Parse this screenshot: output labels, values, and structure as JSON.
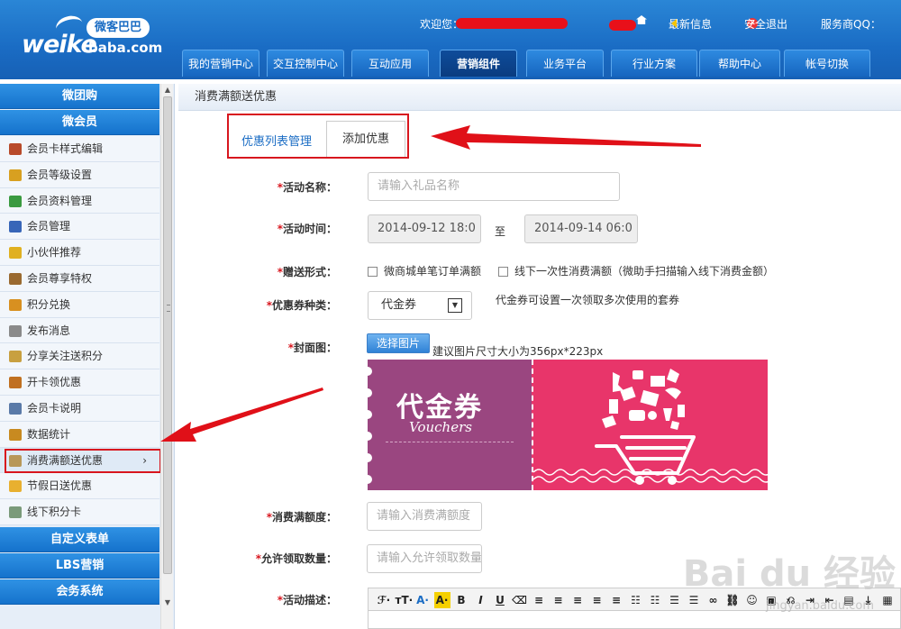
{
  "header": {
    "logo_main": "weike",
    "logo_sub": "baba.com",
    "logo_cn": "微客巴巴",
    "welcome": "欢迎您：",
    "latest_info": "最新信息",
    "logout": "安全退出",
    "provider_qq": "服务商QQ："
  },
  "nav": {
    "tabs": [
      "我的营销中心",
      "交互控制中心",
      "互动应用",
      "营销组件",
      "业务平台",
      "行业方案",
      "帮助中心",
      "帐号切换"
    ],
    "active": "营销组件"
  },
  "sidebar": {
    "groups_top": [
      "微团购",
      "微会员"
    ],
    "items": [
      {
        "label": "会员卡样式编辑",
        "color": "#b84a2a"
      },
      {
        "label": "会员等级设置",
        "color": "#d8a020"
      },
      {
        "label": "会员资料管理",
        "color": "#3a9a40"
      },
      {
        "label": "会员管理",
        "color": "#3866b8"
      },
      {
        "label": "小伙伴推荐",
        "color": "#e0b020"
      },
      {
        "label": "会员尊享特权",
        "color": "#9a6a30"
      },
      {
        "label": "积分兑换",
        "color": "#d89020"
      },
      {
        "label": "发布消息",
        "color": "#8a8a8a"
      },
      {
        "label": "分享关注送积分",
        "color": "#c8a040"
      },
      {
        "label": "开卡领优惠",
        "color": "#c07020"
      },
      {
        "label": "会员卡说明",
        "color": "#5a7aa8"
      },
      {
        "label": "数据统计",
        "color": "#c88a20"
      },
      {
        "label": "消费满额送优惠",
        "color": "#b89858",
        "active": true
      },
      {
        "label": "节假日送优惠",
        "color": "#e8b030"
      },
      {
        "label": "线下积分卡",
        "color": "#7a9a7a"
      }
    ],
    "active_arrow": "›",
    "groups_bottom": [
      "自定义表单",
      "LBS营销",
      "会务系统"
    ]
  },
  "page": {
    "title": "消费满额送优惠",
    "tabs": [
      "优惠列表管理",
      "添加优惠"
    ]
  },
  "form": {
    "req_mark": "*",
    "name_label": "活动名称：",
    "name_placeholder": "请输入礼品名称",
    "time_label": "活动时间：",
    "time_start": "2014-09-12 18:0",
    "time_to": "至",
    "time_end": "2014-09-14 06:0",
    "gift_label": "赠送形式：",
    "gift_opt1": "微商城单笔订单满额",
    "gift_opt2": "线下一次性消费满额（微助手扫描输入线下消费金额）",
    "coupon_type_label": "优惠券种类：",
    "coupon_type_value": "代金券",
    "coupon_type_hint": "代金券可设置一次领取多次使用的套券",
    "cover_label": "封面图：",
    "pick_button": "选择图片",
    "cover_hint": "建议图片尺寸大小为356px*223px",
    "amount_label": "消费满额度：",
    "amount_placeholder": "请输入消费满额度",
    "quantity_label": "允许领取数量：",
    "quantity_placeholder": "请输入允许领取数量",
    "desc_label": "活动描述："
  },
  "coupon_image": {
    "title": "代金券",
    "subtitle": "Vouchers"
  },
  "editor_toolbar": [
    "ℱ·",
    "тT·",
    "A·",
    "A·",
    "B",
    "I",
    "U",
    "⌫",
    "≡",
    "≡",
    "≡",
    "≡",
    "≡",
    "☷",
    "☷",
    "☰",
    "☰",
    "∞",
    "⛓",
    "☺",
    "▣",
    "⎌",
    "⇥",
    "⇤",
    "▤",
    "⤓",
    "▦"
  ],
  "watermark": {
    "main": "Bai du 经验",
    "sub": "jingyan.baidu.com"
  }
}
